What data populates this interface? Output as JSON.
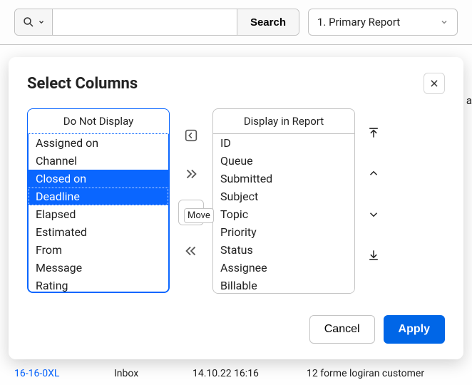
{
  "toolbar": {
    "search_button": "Search",
    "search_placeholder": "",
    "report_selector": "1. Primary Report"
  },
  "bg_row": {
    "c1": "16-16-0XL",
    "c2": "Inbox",
    "c3": "14.10.22 16:16",
    "c4": "12 forme logiran customer"
  },
  "bg_truncated": "tion a",
  "modal": {
    "title": "Select Columns",
    "left_header": "Do Not Display",
    "right_header": "Display in Report",
    "left_items": [
      {
        "label": "Assigned on",
        "selected": false
      },
      {
        "label": "Channel",
        "selected": false
      },
      {
        "label": "Closed on",
        "selected": true
      },
      {
        "label": "Deadline",
        "selected": true,
        "last": true
      },
      {
        "label": "Elapsed",
        "selected": false
      },
      {
        "label": "Estimated",
        "selected": false
      },
      {
        "label": "From",
        "selected": false
      },
      {
        "label": "Message",
        "selected": false
      },
      {
        "label": "Rating",
        "selected": false
      }
    ],
    "right_items": [
      {
        "label": "ID"
      },
      {
        "label": "Queue"
      },
      {
        "label": "Submitted"
      },
      {
        "label": "Subject"
      },
      {
        "label": "Topic"
      },
      {
        "label": "Priority"
      },
      {
        "label": "Status"
      },
      {
        "label": "Assignee"
      },
      {
        "label": "Billable"
      }
    ],
    "tooltip": "Move",
    "cancel": "Cancel",
    "apply": "Apply"
  }
}
